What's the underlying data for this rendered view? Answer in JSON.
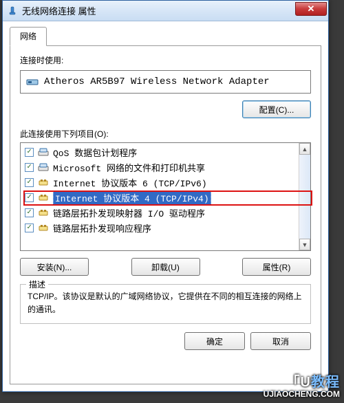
{
  "title": "无线网络连接 属性",
  "tab": {
    "label": "网络"
  },
  "adapter": {
    "label": "连接时使用:",
    "name": "Atheros AR5B97 Wireless Network Adapter"
  },
  "buttons": {
    "configure": "配置(C)...",
    "install": "安装(N)...",
    "uninstall": "卸载(U)",
    "properties": "属性(R)",
    "ok": "确定",
    "cancel": "取消"
  },
  "items_label": "此连接使用下列项目(O):",
  "items": [
    {
      "checked": true,
      "icon": "service",
      "label": "QoS 数据包计划程序"
    },
    {
      "checked": true,
      "icon": "service",
      "label": "Microsoft 网络的文件和打印机共享"
    },
    {
      "checked": true,
      "icon": "protocol",
      "label": "Internet 协议版本 6 (TCP/IPv6)"
    },
    {
      "checked": true,
      "icon": "protocol",
      "label": "Internet 协议版本 4 (TCP/IPv4)",
      "selected": true
    },
    {
      "checked": true,
      "icon": "protocol",
      "label": "链路层拓扑发现映射器 I/O 驱动程序"
    },
    {
      "checked": true,
      "icon": "protocol",
      "label": "链路层拓扑发现响应程序"
    }
  ],
  "description": {
    "title": "描述",
    "text": "TCP/IP。该协议是默认的广域网络协议，它提供在不同的相互连接的网络上的通讯。"
  },
  "watermark": {
    "brand_pre": "「U",
    "brand_post": "教程",
    "url": "UJIAOCHENG.COM"
  }
}
